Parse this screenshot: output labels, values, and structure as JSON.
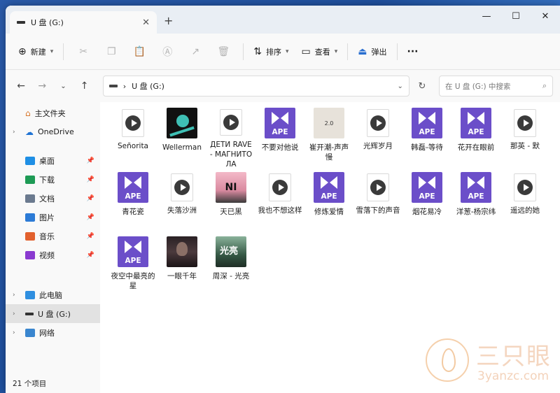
{
  "window": {
    "tab_title": "U 盘 (G:)",
    "tab_close": "✕",
    "new_tab": "+",
    "controls": {
      "minimize": "—",
      "maximize": "☐",
      "close": "✕"
    }
  },
  "toolbar": {
    "new_label": "新建",
    "sort_label": "排序",
    "view_label": "查看",
    "eject_label": "弹出",
    "more_label": "···"
  },
  "address": {
    "path_sep": "›",
    "path": "U 盘 (G:)",
    "search_placeholder": "在 U 盘 (G:) 中搜索"
  },
  "sidebar": {
    "home": "主文件夹",
    "onedrive": "OneDrive",
    "quick_access": [
      {
        "label": "桌面",
        "color": "#1f8fe5"
      },
      {
        "label": "下载",
        "color": "#1e9b55"
      },
      {
        "label": "文档",
        "color": "#6b7a8f"
      },
      {
        "label": "图片",
        "color": "#2c7bd6"
      },
      {
        "label": "音乐",
        "color": "#e2612e"
      },
      {
        "label": "视频",
        "color": "#8a3ad0"
      }
    ],
    "this_pc": "此电脑",
    "usb": "U 盘 (G:)",
    "network": "网络"
  },
  "files": [
    {
      "name": "Señorita",
      "type": "media"
    },
    {
      "name": "Wellerman",
      "type": "img-a"
    },
    {
      "name": "ДЕТИ RAVE - МАГНИТОЛА",
      "type": "media"
    },
    {
      "name": "不要对他说",
      "type": "ape"
    },
    {
      "name": "崔开潮-声声慢",
      "type": "img-b",
      "thumb_text": "2.0"
    },
    {
      "name": "光辉岁月",
      "type": "media"
    },
    {
      "name": "韩磊-等待",
      "type": "ape"
    },
    {
      "name": "花开在眼前",
      "type": "ape"
    },
    {
      "name": "那英 - 默",
      "type": "media"
    },
    {
      "name": "青花瓷",
      "type": "ape"
    },
    {
      "name": "失落沙洲",
      "type": "media"
    },
    {
      "name": "天已黑",
      "type": "img-c",
      "thumb_text": "NI"
    },
    {
      "name": "我也不想这样",
      "type": "media"
    },
    {
      "name": "修炼爱情",
      "type": "ape"
    },
    {
      "name": "雪落下的声音",
      "type": "media"
    },
    {
      "name": "烟花易冷",
      "type": "ape"
    },
    {
      "name": "洋葱-杨宗纬",
      "type": "ape"
    },
    {
      "name": "遥远的她",
      "type": "media"
    },
    {
      "name": "夜空中最亮的星",
      "type": "ape"
    },
    {
      "name": "一眼千年",
      "type": "img-d"
    },
    {
      "name": "周深 - 光亮",
      "type": "img-e",
      "thumb_text": "光亮"
    }
  ],
  "ape_label": "APE",
  "status": {
    "count": "21 个项目"
  },
  "watermark": {
    "cn": "三只眼",
    "en": "3yanzc.com"
  }
}
